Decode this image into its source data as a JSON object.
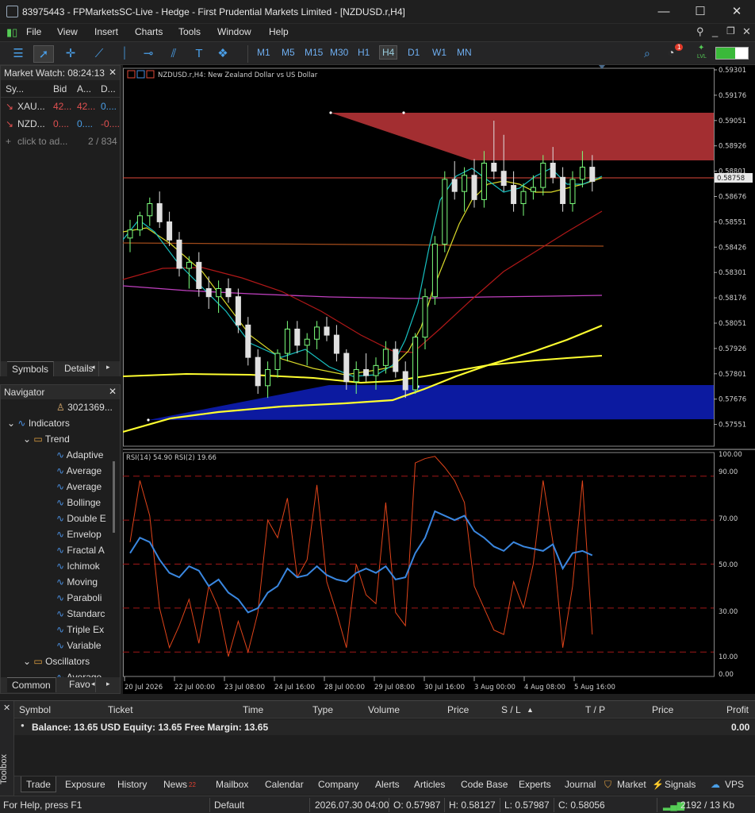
{
  "window": {
    "title": "83975443 - FPMarketsSC-Live - Hedge - First Prudential Markets Limited - [NZDUSD.r,H4]",
    "min_glyph": "—",
    "max_glyph": "☐",
    "close_glyph": "✕"
  },
  "menu": [
    "File",
    "View",
    "Insert",
    "Charts",
    "Tools",
    "Window",
    "Help"
  ],
  "toolbar": {
    "timeframes": [
      "M1",
      "M5",
      "M15",
      "M30",
      "H1",
      "H4",
      "D1",
      "W1",
      "MN"
    ],
    "selected_timeframe": "H4",
    "lvl_label": "LVL",
    "notification_count": "1"
  },
  "market_watch": {
    "title": "Market Watch: 08:24:13",
    "columns": [
      "Sy...",
      "Bid",
      "A...",
      "D..."
    ],
    "rows": [
      {
        "symbol": "XAU...",
        "bid": "42...",
        "ask": "42...",
        "daily": "0...."
      },
      {
        "symbol": "NZD...",
        "bid": "0....",
        "ask": "0....",
        "daily": "-0...."
      }
    ],
    "add_placeholder": "click to ad...",
    "count": "2 / 834",
    "tabs": [
      "Symbols",
      "Details"
    ]
  },
  "navigator": {
    "title": "Navigator",
    "account": "3021369...",
    "indicators_label": "Indicators",
    "trend_label": "Trend",
    "trend_items": [
      "Adaptive",
      "Average",
      "Average",
      "Bollinge",
      "Double E",
      "Envelop",
      "Fractal A",
      "Ichimok",
      "Moving",
      "Paraboli",
      "Standarc",
      "Triple Ex",
      "Variable"
    ],
    "oscillators_label": "Oscillators",
    "oscillator_items": [
      "Average"
    ],
    "tabs": [
      "Common",
      "Favo"
    ]
  },
  "chart": {
    "header": "NZDUSD.r,H4:  New Zealand Dollar vs US Dollar",
    "rsi_header": "RSI(14) 54.90 RSI(2) 19.66",
    "current_price": "0.58758",
    "price_labels": [
      "0.59301",
      "0.59176",
      "0.59051",
      "0.58926",
      "0.58801",
      "0.58676",
      "0.58551",
      "0.58426",
      "0.58301",
      "0.58176",
      "0.58051",
      "0.57926",
      "0.57801",
      "0.57676",
      "0.57551"
    ],
    "rsi_labels": [
      "100.00",
      "90.00",
      "70.00",
      "50.00",
      "30.00",
      "10.00",
      "0.00"
    ],
    "time_labels": [
      "20 Jul 2026",
      "22 Jul 00:00",
      "23 Jul 08:00",
      "24 Jul 16:00",
      "28 Jul 00:00",
      "29 Jul 08:00",
      "30 Jul 16:00",
      "3 Aug 00:00",
      "4 Aug 08:00",
      "5 Aug 16:00"
    ],
    "colors": {
      "bull": "#7dff7d",
      "bear": "#e0e0e0",
      "rsi14": "#3a87e0",
      "rsi2": "#e0441a",
      "zone_red": "#c0363a",
      "zone_blue": "#0c1aa0",
      "ema_fast": "#17c0c0",
      "ema_mid": "#d9d92a",
      "ema_slow": "#b01818",
      "ma_magenta": "#c040c0",
      "ma_yellow": "#ffff30"
    }
  },
  "toolbox": {
    "label": "Toolbox",
    "columns": [
      "Symbol",
      "Ticket",
      "Time",
      "Type",
      "Volume",
      "Price",
      "S / L",
      "T / P",
      "Price",
      "Profit"
    ],
    "balance_line": "Balance: 13.65 USD  Equity: 13.65  Free Margin: 13.65",
    "balance_profit": "0.00",
    "tabs": [
      "Trade",
      "Exposure",
      "History",
      "News",
      "Mailbox",
      "Calendar",
      "Company",
      "Alerts",
      "Articles",
      "Code Base",
      "Experts",
      "Journal"
    ],
    "news_count": "22",
    "right_tabs": [
      "Market",
      "Signals",
      "VPS"
    ]
  },
  "status": {
    "help": "For Help, press F1",
    "profile": "Default",
    "datetime": "2026.07.30 04:00",
    "open": "O: 0.57987",
    "high": "H: 0.58127",
    "low": "L: 0.57987",
    "close": "C: 0.58056",
    "traffic": "2192 / 13 Kb"
  }
}
